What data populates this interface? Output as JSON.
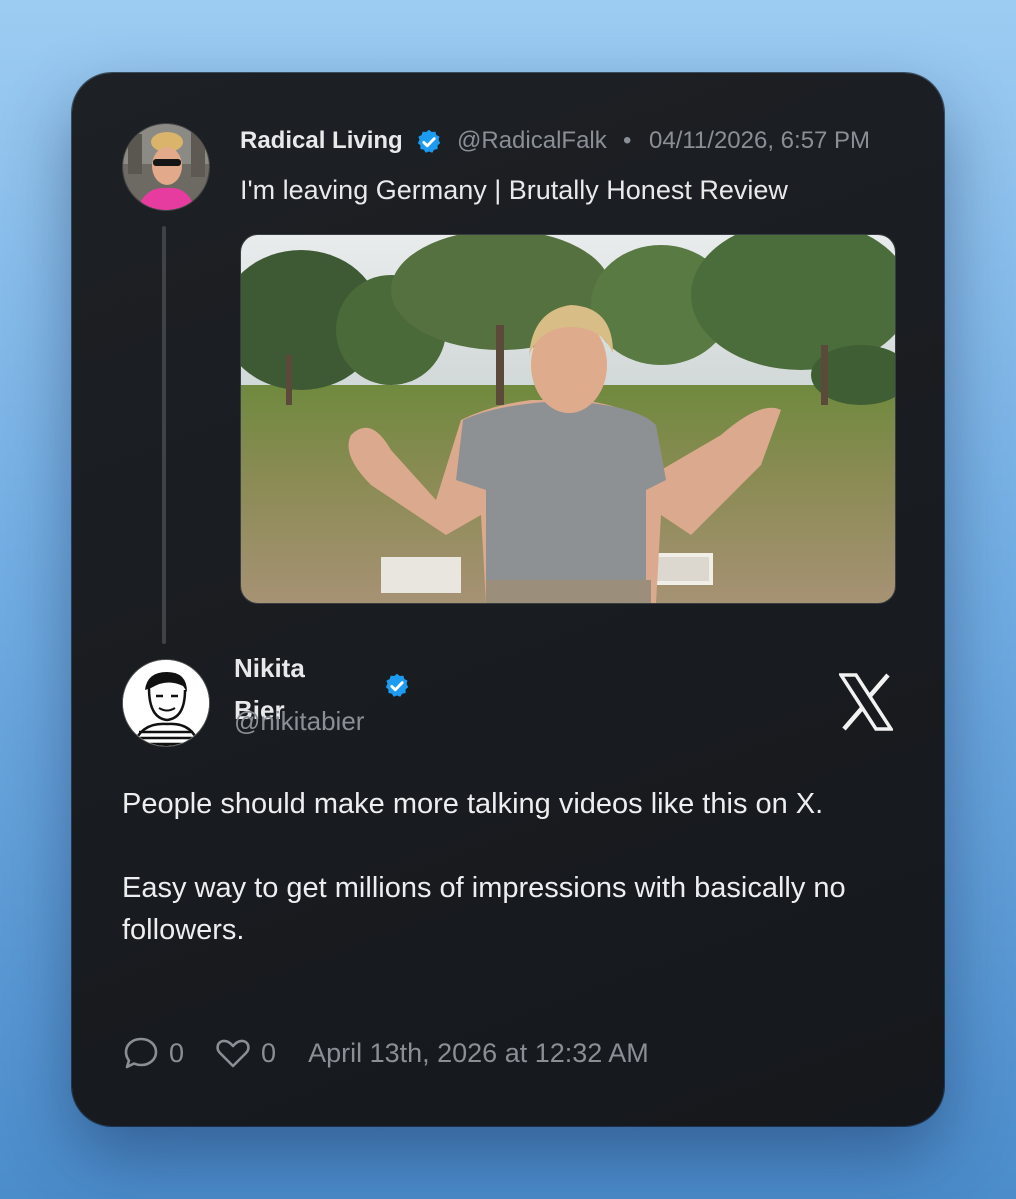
{
  "quoted": {
    "name": "Radical Living",
    "handle": "@RadicalFalk",
    "separator": "•",
    "date": "04/11/2026, 6:57 PM",
    "text": "I'm leaving Germany | Brutally Honest Review",
    "media": "video-thumbnail"
  },
  "tweet": {
    "name": "Nikita Bier",
    "handle": "@nikitabier",
    "body": [
      "People should make more talking videos like this on X.",
      "Easy way to get millions of impressions with basically no followers."
    ],
    "comments": "0",
    "likes": "0",
    "timestamp": "April 13th, 2026 at 12:32 AM"
  },
  "icons": {
    "verified": "verified-badge-icon",
    "brand": "x-logo-icon",
    "comment": "comment-icon",
    "like": "heart-icon"
  },
  "colors": {
    "verified": "#1d9bf0",
    "card_bg": "#181b1f",
    "text": "#e8e9eb",
    "muted": "#8a8f96"
  }
}
